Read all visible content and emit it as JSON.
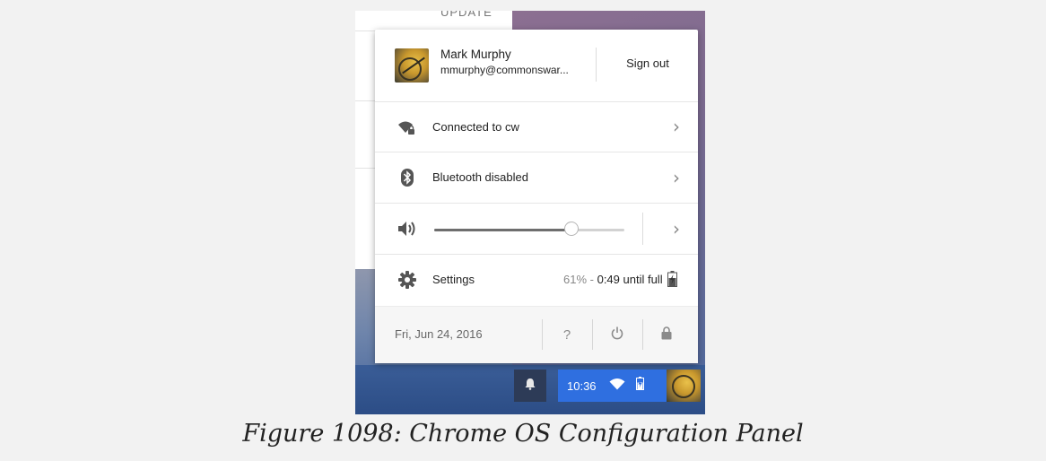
{
  "background_window": {
    "top_text": "UPDATE"
  },
  "user": {
    "name": "Mark Murphy",
    "email": "mmurphy@commonswar...",
    "sign_out_label": "Sign out"
  },
  "network": {
    "label": "Connected to cw",
    "icon": "wifi-locked-icon"
  },
  "bluetooth": {
    "label": "Bluetooth disabled",
    "icon": "bluetooth-icon"
  },
  "volume": {
    "icon": "speaker-icon",
    "level_fraction": 0.72
  },
  "settings": {
    "label": "Settings",
    "battery_percent": "61%",
    "battery_separator": " - ",
    "battery_time": "0:49 until full",
    "icon": "gear-icon",
    "battery_icon": "battery-charging-icon"
  },
  "footer": {
    "date": "Fri, Jun 24, 2016",
    "help_label": "?",
    "power_icon": "power-icon",
    "lock_icon": "lock-icon"
  },
  "shelf": {
    "time": "10:36",
    "notification_icon": "bell-icon",
    "wifi_icon": "wifi-icon",
    "battery_icon": "battery-charging-icon"
  },
  "caption": "Figure 1098: Chrome OS Configuration Panel",
  "colors": {
    "status_area": "#2f6fe0",
    "notification_button": "#2d3b57",
    "panel_bg": "#ffffff",
    "page_bg": "#f2f2f2"
  }
}
